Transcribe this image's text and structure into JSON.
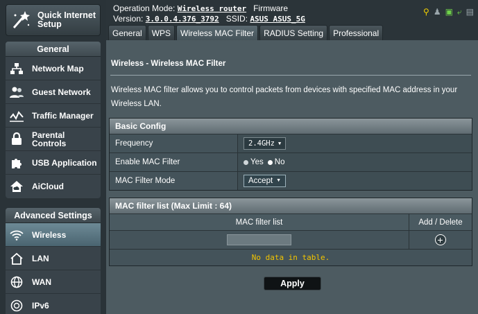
{
  "sidebar": {
    "quick_setup": "Quick Internet Setup",
    "general_header": "General",
    "general_items": [
      "Network Map",
      "Guest Network",
      "Traffic Manager",
      "Parental Controls",
      "USB Application",
      "AiCloud"
    ],
    "advanced_header": "Advanced Settings",
    "advanced_items": [
      "Wireless",
      "LAN",
      "WAN",
      "IPv6"
    ]
  },
  "header": {
    "op_mode_label": "Operation Mode:",
    "op_mode_value": "Wireless router",
    "firmware_label": "Firmware",
    "version_label": "Version:",
    "version_value": "3.0.0.4.376_3792",
    "ssid_label": "SSID:",
    "ssid_value": "ASUS  ASUS_5G"
  },
  "tabs": [
    "General",
    "WPS",
    "Wireless MAC Filter",
    "RADIUS Setting",
    "Professional"
  ],
  "active_tab": "Wireless MAC Filter",
  "main": {
    "title": "Wireless - Wireless MAC Filter",
    "description": "Wireless MAC filter allows you to control packets from devices with specified MAC address in your Wireless LAN.",
    "basic_config": {
      "header": "Basic Config",
      "frequency_label": "Frequency",
      "frequency_value": "2.4GHz",
      "enable_label": "Enable MAC Filter",
      "yes_label": "Yes",
      "no_label": "No",
      "mode_label": "MAC Filter Mode",
      "mode_value": "Accept"
    },
    "mac_list": {
      "header": "MAC filter list (Max Limit : 64)",
      "col_list": "MAC filter list",
      "col_action": "Add / Delete",
      "input_value": "",
      "empty_text": "No data in table."
    },
    "apply_label": "Apply"
  },
  "colors": {
    "accent_active": "#5b7682",
    "nodata_text": "#f2c400",
    "main_bg": "#4d5b61"
  }
}
